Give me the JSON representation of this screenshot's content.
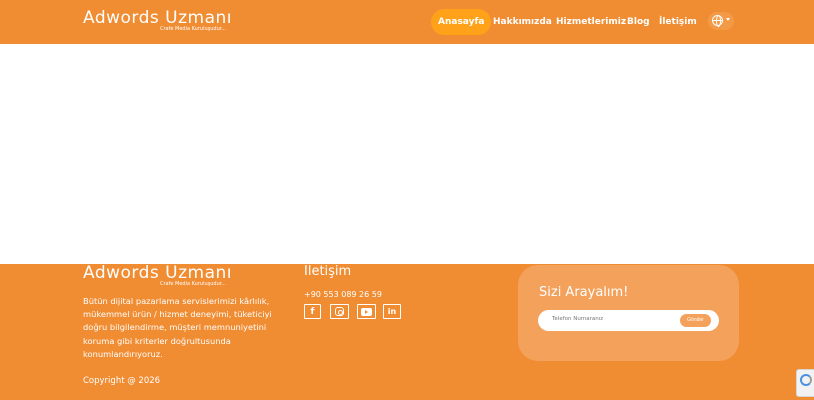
{
  "header": {
    "logo_main": "Adwords Uzmanı",
    "logo_sub": "Crafe Media Kuruluşudur...",
    "nav": [
      {
        "label": "Anasayfa",
        "active": true
      },
      {
        "label": "Hakkımızda",
        "active": false
      },
      {
        "label": "Hizmetlerimiz",
        "active": false
      },
      {
        "label": "Blog",
        "active": false
      },
      {
        "label": "İletişim",
        "active": false
      }
    ],
    "language_icon": "globe-icon"
  },
  "footer": {
    "logo_main": "Adwords Uzmanı",
    "logo_sub": "Crafe Media Kuruluşudur...",
    "description": "Bütün dijital pazarlama servislerimizi kârlılık, mükemmel ürün / hizmet deneyimi, tüketiciyi doğru bilgilendirme, müşteri memnuniyetini koruma gibi kriterler doğrultusunda konumlandırıyoruz.",
    "copyright": "Copyright @ 2026",
    "contact_title": "İletişim",
    "phone": "+90 553 089 26 59",
    "social": [
      "facebook-icon",
      "instagram-icon",
      "youtube-icon",
      "linkedin-icon"
    ],
    "callback": {
      "title": "Sizi Arayalım!",
      "placeholder": "Telefon Numaranız",
      "button": "Gönder"
    }
  },
  "colors": {
    "brand_orange": "#f08c32",
    "active_nav": "#ffa21a",
    "callback_box": "#f4a15c"
  }
}
